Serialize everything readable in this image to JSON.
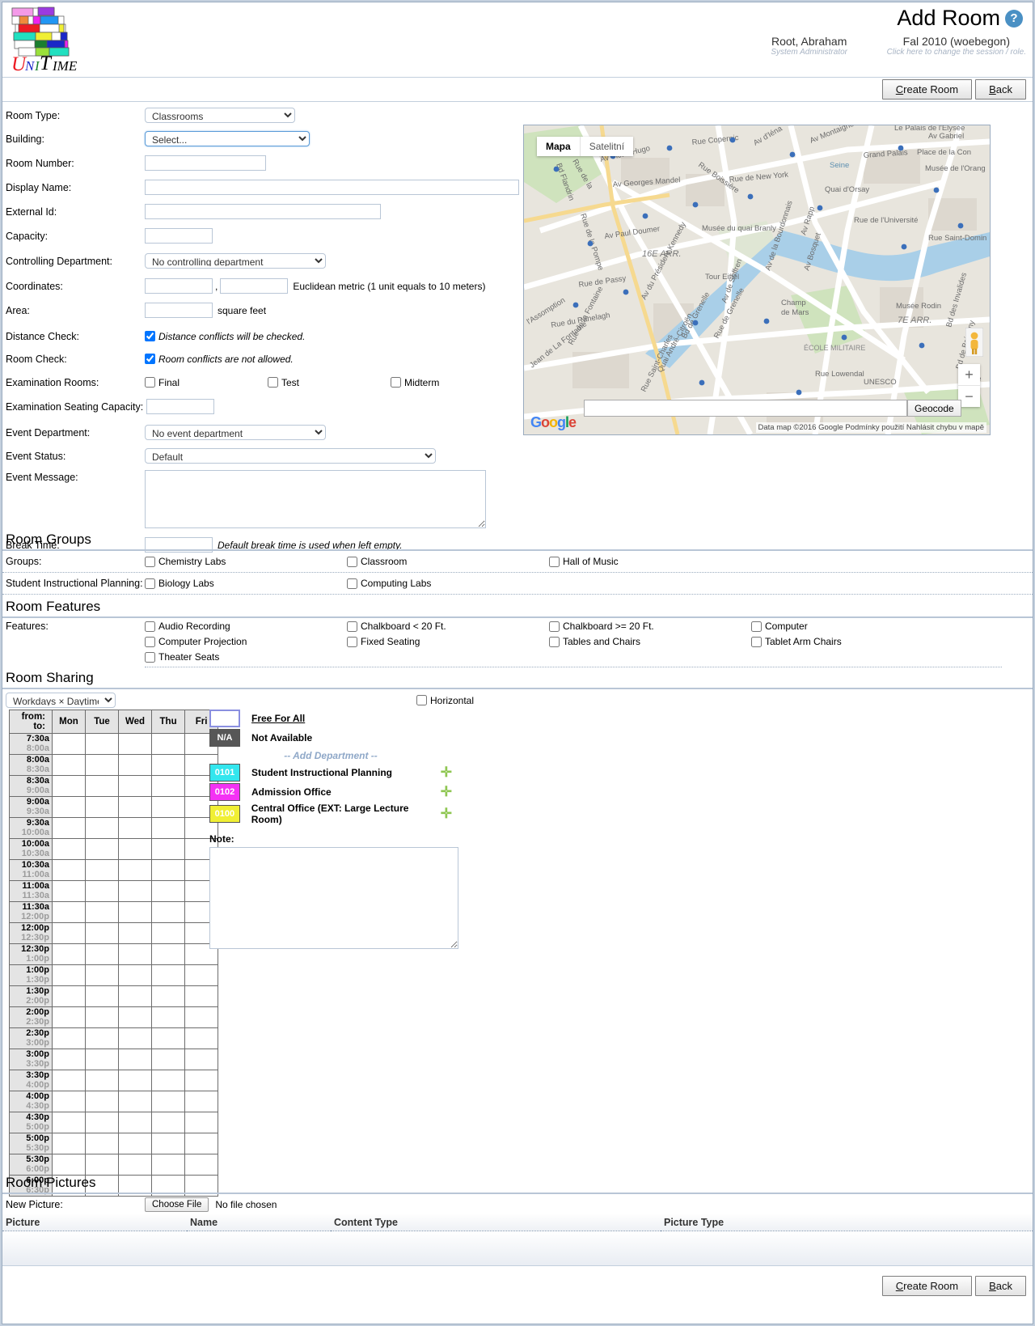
{
  "header": {
    "title": "Add Room",
    "help_icon": "question-mark-icon",
    "user_name": "Root, Abraham",
    "user_role": "System Administrator",
    "session": "Fal 2010 (woebegon)",
    "session_hint": "Click here to change the session / role."
  },
  "toolbar": {
    "create_room": "Create Room",
    "back": "Back"
  },
  "form": {
    "room_type": {
      "label": "Room Type:",
      "value": "Classrooms"
    },
    "building": {
      "label": "Building:",
      "value": "Select..."
    },
    "room_number": {
      "label": "Room Number:",
      "value": ""
    },
    "display_name": {
      "label": "Display Name:",
      "value": ""
    },
    "external_id": {
      "label": "External Id:",
      "value": ""
    },
    "capacity": {
      "label": "Capacity:",
      "value": ""
    },
    "controlling_department": {
      "label": "Controlling Department:",
      "value": "No controlling department"
    },
    "coordinates": {
      "label": "Coordinates:",
      "x": "",
      "y": "",
      "separator": ",",
      "hint": "Euclidean metric (1 unit equals to 10 meters)"
    },
    "area": {
      "label": "Area:",
      "value": "",
      "unit": "square feet"
    },
    "distance_check": {
      "label": "Distance Check:",
      "text": "Distance conflicts will be checked.",
      "checked": true
    },
    "room_check": {
      "label": "Room Check:",
      "text": "Room conflicts are not allowed.",
      "checked": true
    },
    "examination_rooms": {
      "label": "Examination Rooms:",
      "options": [
        "Final",
        "Test",
        "Midterm"
      ]
    },
    "examination_seating_capacity": {
      "label": "Examination Seating Capacity:",
      "value": ""
    },
    "event_department": {
      "label": "Event Department:",
      "value": "No event department"
    },
    "event_status": {
      "label": "Event Status:",
      "value": "Default"
    },
    "event_message": {
      "label": "Event Message:",
      "value": ""
    },
    "break_time": {
      "label": "Break Time:",
      "value": "",
      "hint": "Default break time is used when left empty."
    }
  },
  "map": {
    "tab_map": "Mapa",
    "tab_satellite": "Satelitní",
    "geocode_button": "Geocode",
    "geocode_value": "",
    "brand": "Google",
    "attribution": "Data map ©2016 Google  Podmínky použití  Nahlásit chybu v mapě",
    "zoom_in": "+",
    "zoom_out": "−",
    "labels": [
      "Rue Copernic",
      "Av Victor Hugo",
      "Rue Boissière",
      "Av d'Iéna",
      "Av Montaigne",
      "Grand Palais",
      "Place de la Con",
      "Av Gabriel",
      "Le Palais de l'Élysée",
      "Bd Flandrin",
      "Rue de la",
      "Av Georges Mandel",
      "Rue de New York",
      "Seine",
      "Musée de l'Orang",
      "Quai d'Orsay",
      "Rue de la Pompe",
      "Av Paul Doumer",
      "Musée du quai Branly",
      "Av Rapp",
      "Rue de l'Université",
      "Rue Saint-Domin",
      "16E ARR.",
      "Tour Eiffel",
      "Av de la Bourdonnais",
      "Av Bosquet",
      "Rue de Passy",
      "Rue de Passy",
      "Av de Suffren",
      "Champ de Mars",
      "Musée Rodin",
      "7E ARR.",
      "Rue du Ranelagh",
      "Av du Président Kennedy",
      "Bd de Grenelle",
      "Rue de Grenelle",
      "l'Assomption",
      "Rue de la Fontaine",
      "ÉCOLE MILITAIRE",
      "Bd des Invalides",
      "Bd de Brétigny",
      "Rue",
      "Jean de La Fontaine",
      "Quai André-Citroën",
      "Rue Lowendal",
      "UNESCO",
      "Rue Saint-Charles"
    ]
  },
  "room_groups": {
    "section_title": "Room Groups",
    "rows": [
      {
        "label": "Groups:",
        "items": [
          "Chemistry Labs",
          "Classroom",
          "Hall of Music"
        ]
      },
      {
        "label": "Student Instructional Planning:",
        "items": [
          "Biology Labs",
          "Computing Labs"
        ]
      }
    ]
  },
  "room_features": {
    "section_title": "Room Features",
    "label": "Features:",
    "items": [
      "Audio Recording",
      "Chalkboard < 20 Ft.",
      "Chalkboard >= 20 Ft.",
      "Computer",
      "Computer Projection",
      "Fixed Seating",
      "Tables and Chairs",
      "Tablet Arm Chairs",
      "Theater Seats"
    ]
  },
  "room_sharing": {
    "section_title": "Room Sharing",
    "mode_select": "Workdays × Daytime",
    "horizontal": "Horizontal",
    "from_label": "from:",
    "to_label": "to:",
    "days": [
      "Mon",
      "Tue",
      "Wed",
      "Thu",
      "Fri"
    ],
    "times": [
      {
        "from": "7:30a",
        "to": "8:00a"
      },
      {
        "from": "8:00a",
        "to": "8:30a"
      },
      {
        "from": "8:30a",
        "to": "9:00a"
      },
      {
        "from": "9:00a",
        "to": "9:30a"
      },
      {
        "from": "9:30a",
        "to": "10:00a"
      },
      {
        "from": "10:00a",
        "to": "10:30a"
      },
      {
        "from": "10:30a",
        "to": "11:00a"
      },
      {
        "from": "11:00a",
        "to": "11:30a"
      },
      {
        "from": "11:30a",
        "to": "12:00p"
      },
      {
        "from": "12:00p",
        "to": "12:30p"
      },
      {
        "from": "12:30p",
        "to": "1:00p"
      },
      {
        "from": "1:00p",
        "to": "1:30p"
      },
      {
        "from": "1:30p",
        "to": "2:00p"
      },
      {
        "from": "2:00p",
        "to": "2:30p"
      },
      {
        "from": "2:30p",
        "to": "3:00p"
      },
      {
        "from": "3:00p",
        "to": "3:30p"
      },
      {
        "from": "3:30p",
        "to": "4:00p"
      },
      {
        "from": "4:00p",
        "to": "4:30p"
      },
      {
        "from": "4:30p",
        "to": "5:00p"
      },
      {
        "from": "5:00p",
        "to": "5:30p"
      },
      {
        "from": "5:30p",
        "to": "6:00p"
      },
      {
        "from": "6:00p",
        "to": "6:30p"
      }
    ],
    "legend": [
      {
        "code": "",
        "label": "Free For All",
        "color": "#ffffff",
        "text_color": "#000000",
        "underline": true
      },
      {
        "code": "N/A",
        "label": "Not Available",
        "color": "#575757",
        "text_color": "#ffffff",
        "underline": false
      }
    ],
    "add_department": "-- Add Department --",
    "departments": [
      {
        "code": "0101",
        "label": "Student Instructional Planning",
        "color": "#33e6ee",
        "text_color": "#ffffff"
      },
      {
        "code": "0102",
        "label": "Admission Office",
        "color": "#f432f4",
        "text_color": "#ffffff"
      },
      {
        "code": "0100",
        "label": "Central Office (EXT: Large Lecture Room)",
        "color": "#f0ef34",
        "text_color": "#ffffff"
      }
    ],
    "note_label": "Note:",
    "note_value": ""
  },
  "room_pictures": {
    "section_title": "Room Pictures",
    "new_picture_label": "New Picture:",
    "choose_file": "Choose File",
    "no_file": "No file chosen",
    "columns": [
      "Picture",
      "Name",
      "Content Type",
      "Picture Type"
    ],
    "rows": []
  },
  "footer": {
    "create_room": "Create Room",
    "back": "Back"
  }
}
